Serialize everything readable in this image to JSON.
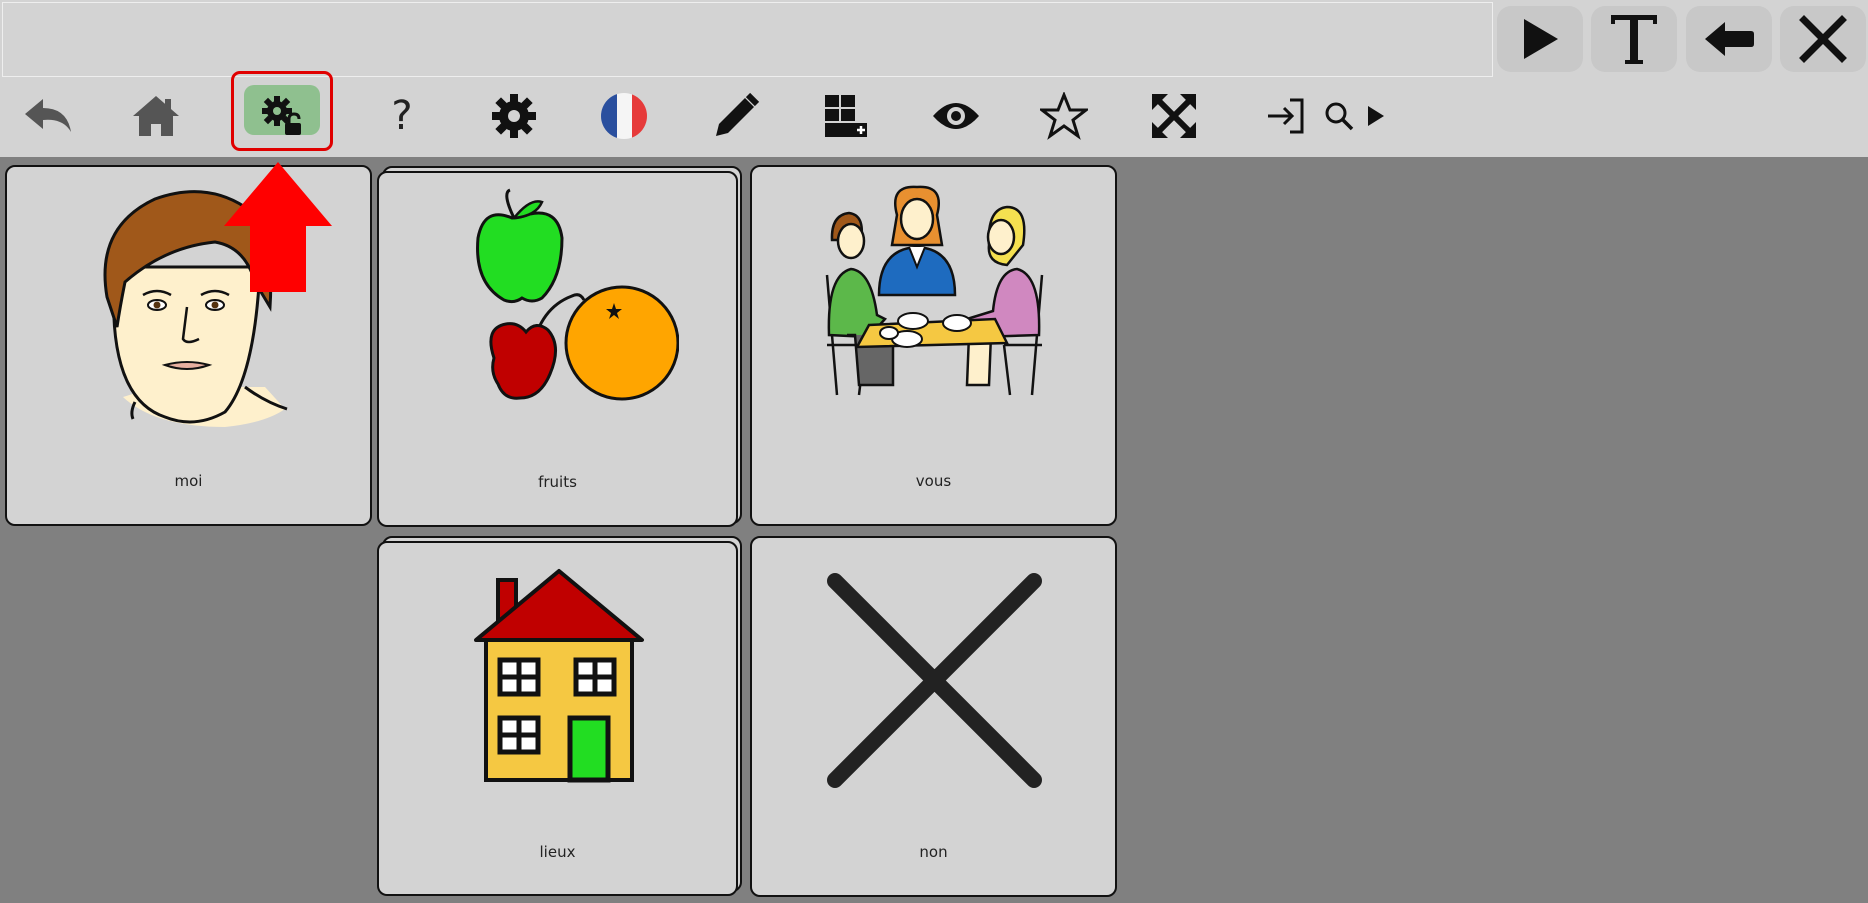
{
  "textbar": {
    "value": ""
  },
  "top_buttons": [
    {
      "icon": "play-icon"
    },
    {
      "icon": "text-icon"
    },
    {
      "icon": "backspace-icon"
    },
    {
      "icon": "clear-icon"
    }
  ],
  "toolbar": {
    "help_label": "?",
    "items": [
      "back-icon",
      "home-icon",
      "unlock-settings-icon",
      "help-icon",
      "settings-icon",
      "french-flag-icon",
      "edit-icon",
      "add-grid-icon",
      "eye-icon",
      "star-icon",
      "fullscreen-icon",
      "login-icon",
      "search-icon",
      "triangle-right-icon"
    ]
  },
  "cards": {
    "moi": "moi",
    "fruits": "fruits",
    "vous": "vous",
    "lieux": "lieux",
    "non": "non"
  },
  "colors": {
    "background": "#808080",
    "bar": "#d3d3d3",
    "card": "#d3d3d3",
    "highlight": "#e00000",
    "unlock_button": "#8fc08f"
  }
}
